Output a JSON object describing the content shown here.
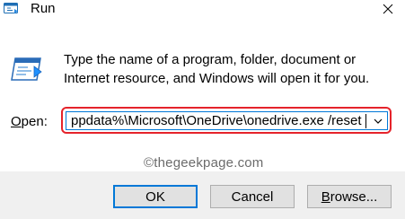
{
  "window": {
    "title": "Run",
    "app_icon": "run-icon",
    "close_icon": "close-icon"
  },
  "dialog": {
    "icon": "run-program-icon",
    "description": "Type the name of a program, folder, document or Internet resource, and Windows will open it for you."
  },
  "open_field": {
    "label_accel": "O",
    "label_rest": "pen:",
    "value": "ppdata%\\Microsoft\\OneDrive\\onedrive.exe /reset",
    "dropdown_icon": "chevron-down-icon",
    "highlight_color": "#e5232b"
  },
  "watermark": "©thegeekpage.com",
  "buttons": {
    "ok": "OK",
    "cancel": "Cancel",
    "browse_accel": "B",
    "browse_rest": "rowse..."
  }
}
